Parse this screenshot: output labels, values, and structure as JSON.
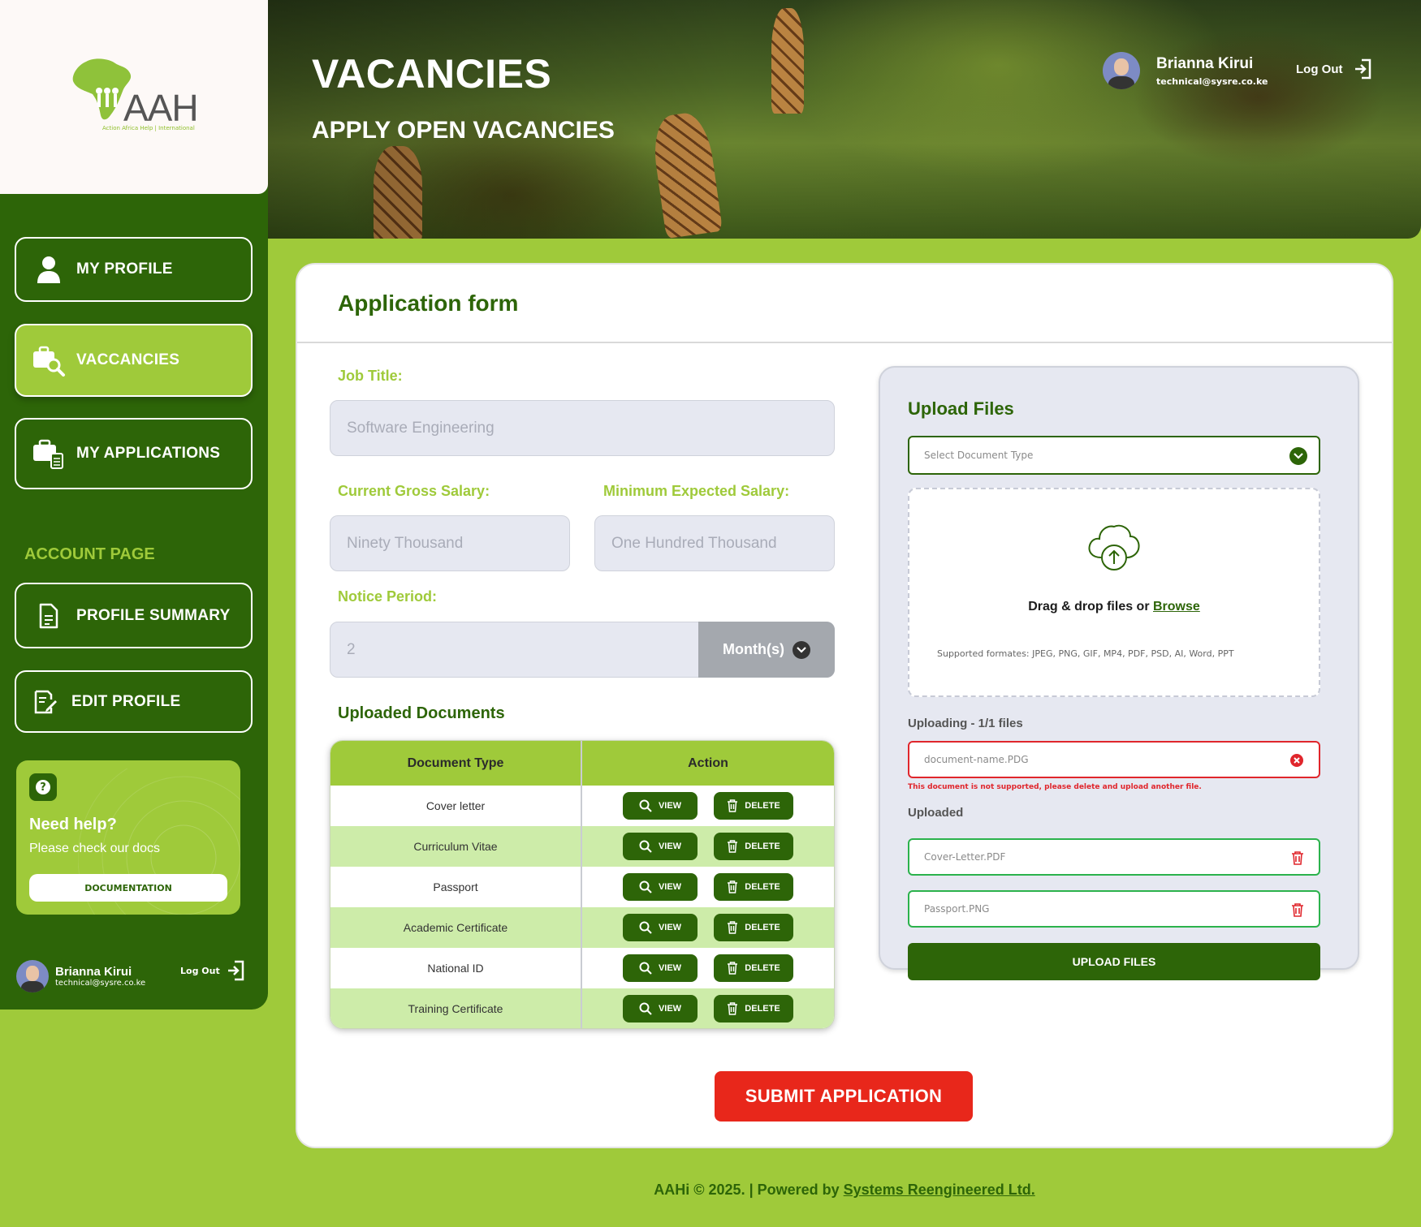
{
  "brand": {
    "logo_text": "AAH",
    "logo_tagline": "Action Africa Help | International"
  },
  "sidebar": {
    "nav": [
      {
        "label": "MY PROFILE",
        "icon": "user-icon"
      },
      {
        "label": "VACCANCIES",
        "icon": "briefcase-search-icon",
        "active": true
      },
      {
        "label": "MY APPLICATIONS",
        "icon": "briefcase-document-icon"
      }
    ],
    "account_title": "ACCOUNT PAGE",
    "account_nav": [
      {
        "label": "PROFILE SUMMARY",
        "icon": "document-icon"
      },
      {
        "label": "EDIT PROFILE",
        "icon": "edit-document-icon"
      }
    ],
    "help": {
      "title": "Need help?",
      "text": "Please check our docs",
      "button": "DOCUMENTATION"
    },
    "user": {
      "name": "Brianna Kirui",
      "email": "technical@sysre.co.ke"
    },
    "logout": "Log Out"
  },
  "header": {
    "title": "VACANCIES",
    "subtitle": "APPLY OPEN VACANCIES",
    "user": {
      "name": "Brianna Kirui",
      "email": "technical@sysre.co.ke"
    },
    "logout": "Log Out"
  },
  "form": {
    "title": "Application form",
    "job_title": {
      "label": "Job Title:",
      "placeholder": "Software Engineering"
    },
    "current_salary": {
      "label": "Current Gross Salary:",
      "placeholder": "Ninety Thousand"
    },
    "expected_salary": {
      "label": "Minimum Expected Salary:",
      "placeholder": "One Hundred Thousand"
    },
    "notice": {
      "label": "Notice Period:",
      "placeholder": "2",
      "unit": "Month(s)"
    },
    "documents": {
      "title": "Uploaded Documents",
      "columns": [
        "Document Type",
        "Action"
      ],
      "rows": [
        "Cover letter",
        "Curriculum Vitae",
        "Passport",
        "Academic Certificate",
        "National ID",
        "Training Certificate"
      ],
      "view_label": "VIEW",
      "delete_label": "DELETE"
    },
    "submit": "SUBMIT APPLICATION"
  },
  "upload": {
    "title": "Upload Files",
    "select_placeholder": "Select Document Type",
    "drop_text": "Drag & drop files or ",
    "browse": "Browse",
    "supported": "Supported formates: JPEG, PNG, GIF, MP4, PDF, PSD, AI, Word, PPT",
    "uploading_label": "Uploading - 1/1 files",
    "uploading_file": "document-name.PDG",
    "error": "This document is not supported, please delete and upload another file.",
    "uploaded_label": "Uploaded",
    "uploaded_files": [
      "Cover-Letter.PDF",
      "Passport.PNG"
    ],
    "button": "UPLOAD FILES"
  },
  "footer": {
    "text": "AAHi © 2025. | Powered by ",
    "link": "Systems Reengineered Ltd."
  },
  "colors": {
    "dark_green": "#2d6508",
    "lime": "#9fca3a",
    "red": "#e8271b",
    "light_row": "#cdeca9"
  }
}
